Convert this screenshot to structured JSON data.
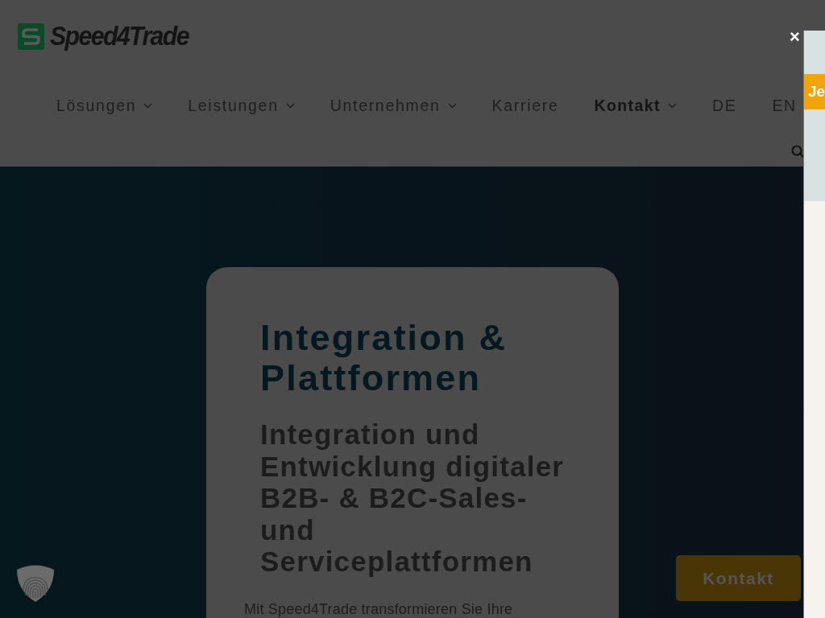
{
  "overlay": {
    "dimmed": true,
    "close_label": "×"
  },
  "header": {
    "logo": {
      "text": "Speed4Trade"
    },
    "nav": [
      {
        "label": "Lösungen",
        "has_submenu": true,
        "selected": false
      },
      {
        "label": "Leistungen",
        "has_submenu": true,
        "selected": false
      },
      {
        "label": "Unternehmen",
        "has_submenu": true,
        "selected": false
      },
      {
        "label": "Karriere",
        "has_submenu": false,
        "selected": false
      },
      {
        "label": "Kontakt",
        "has_submenu": true,
        "selected": true
      },
      {
        "label": "DE",
        "has_submenu": false,
        "selected": false
      },
      {
        "label": "EN",
        "has_submenu": false,
        "selected": false
      }
    ]
  },
  "hero": {
    "card": {
      "title": "Integration & Plattformen",
      "subtitle": "Integration und Entwicklung digitaler B2B- & B2C-Sales- und Serviceplattformen",
      "text": "Mit Speed4Trade transformieren Sie Ihre"
    }
  },
  "contact_button": {
    "label": "Kontakt"
  },
  "side_panel": {
    "banner": "Je"
  }
}
